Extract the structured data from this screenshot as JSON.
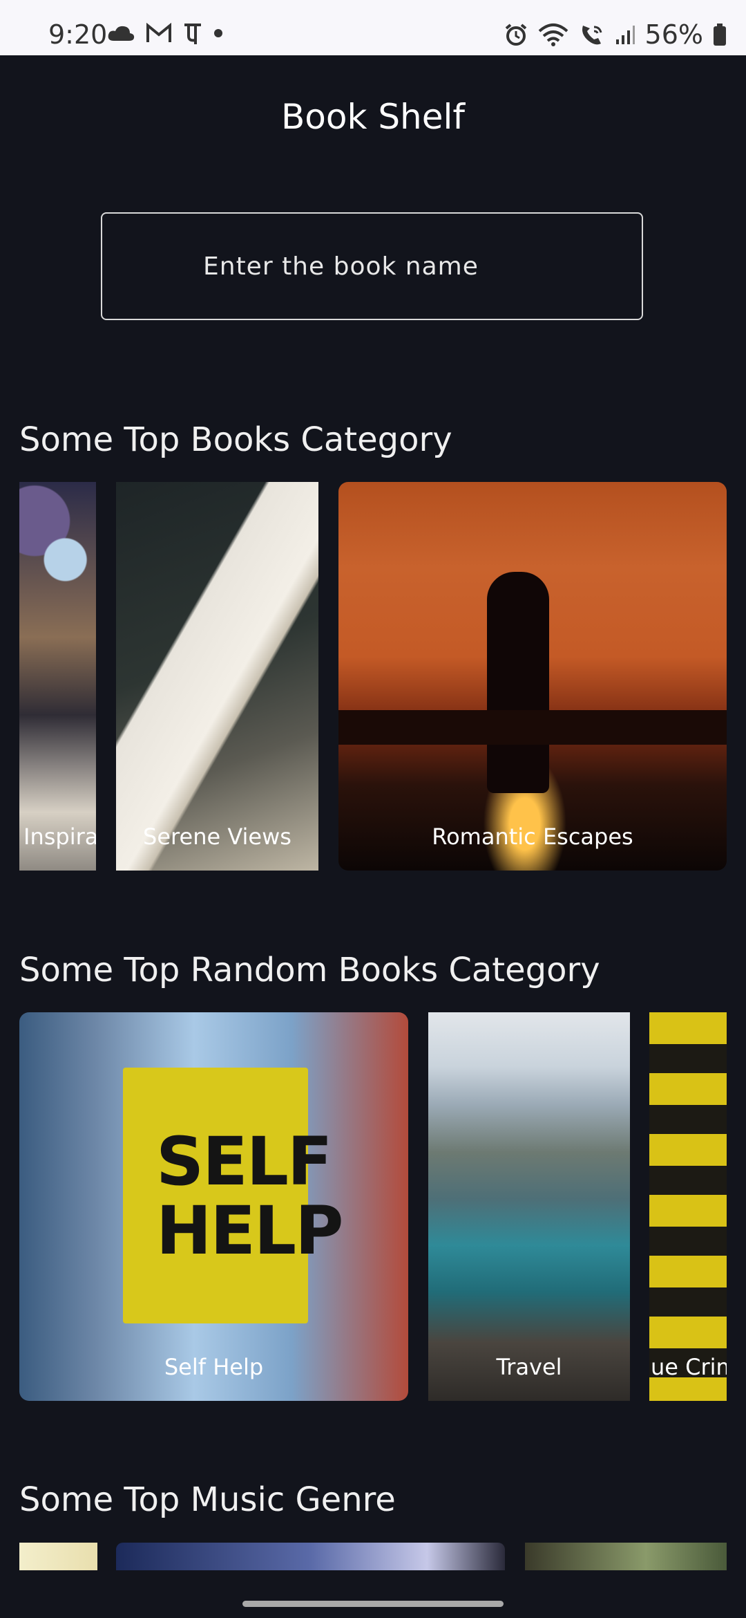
{
  "status_bar": {
    "time": "9:20",
    "battery": "56%",
    "left_icons": [
      "cloud-icon",
      "gmail-icon",
      "phonepe-icon",
      "dot-icon"
    ],
    "right_icons": [
      "alarm-icon",
      "wifi-icon",
      "wifi-call-icon",
      "signal-icon",
      "battery-icon"
    ]
  },
  "app": {
    "title": "Book Shelf",
    "search_placeholder": "Enter the book name"
  },
  "sections": [
    {
      "title": "Some Top Books Category",
      "cards": [
        {
          "label": "Inspirat"
        },
        {
          "label": "Serene Views"
        },
        {
          "label": "Romantic Escapes"
        }
      ]
    },
    {
      "title": "Some Top Random Books Category",
      "cards": [
        {
          "label": "Self Help"
        },
        {
          "label": "Travel"
        },
        {
          "label": "ue Crim"
        }
      ]
    },
    {
      "title": "Some Top Music Genre"
    }
  ],
  "book_cover_text": [
    "SELF",
    "HELP"
  ]
}
